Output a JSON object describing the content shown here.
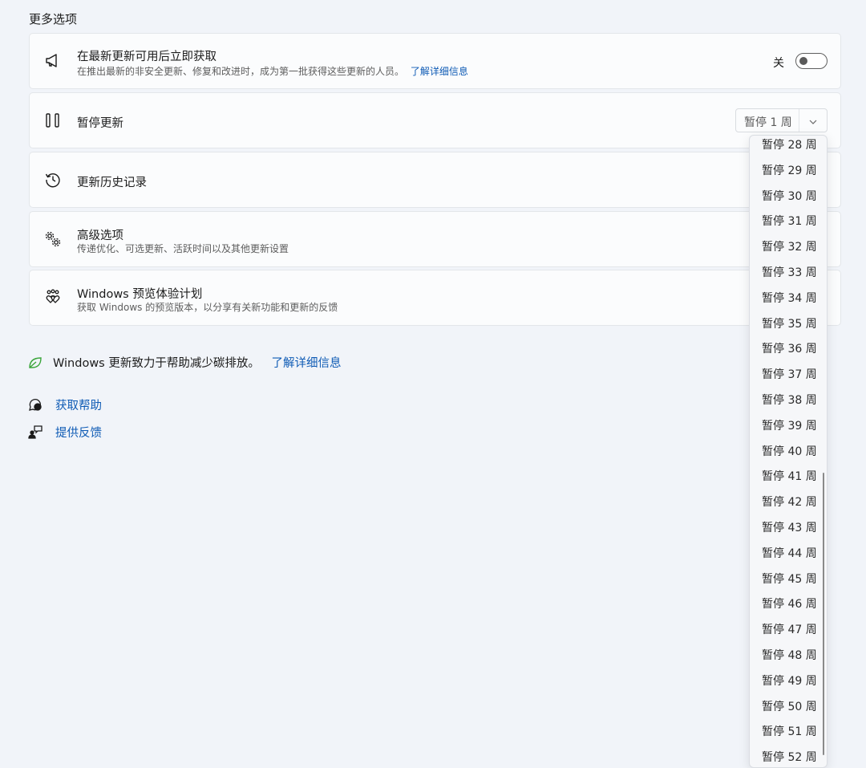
{
  "section": {
    "title": "更多选项"
  },
  "cards": {
    "latest": {
      "title": "在最新更新可用后立即获取",
      "desc": "在推出最新的非安全更新、修复和改进时，成为第一批获得这些更新的人员。",
      "link": "了解详细信息",
      "toggle_label": "关",
      "toggle_state": "off"
    },
    "pause": {
      "title": "暂停更新",
      "select_value": "暂停 1 周"
    },
    "history": {
      "title": "更新历史记录"
    },
    "advanced": {
      "title": "高级选项",
      "desc": "传递优化、可选更新、活跃时间以及其他更新设置"
    },
    "insider": {
      "title": "Windows 预览体验计划",
      "desc": "获取 Windows 的预览版本，以分享有关新功能和更新的反馈"
    }
  },
  "eco": {
    "text": "Windows 更新致力于帮助减少碳排放。",
    "link": "了解详细信息"
  },
  "help": {
    "get_help": "获取帮助",
    "feedback": "提供反馈"
  },
  "dropdown": {
    "options": [
      "暂停 28 周",
      "暂停 29 周",
      "暂停 30 周",
      "暂停 31 周",
      "暂停 32 周",
      "暂停 33 周",
      "暂停 34 周",
      "暂停 35 周",
      "暂停 36 周",
      "暂停 37 周",
      "暂停 38 周",
      "暂停 39 周",
      "暂停 40 周",
      "暂停 41 周",
      "暂停 42 周",
      "暂停 43 周",
      "暂停 44 周",
      "暂停 45 周",
      "暂停 46 周",
      "暂停 47 周",
      "暂停 48 周",
      "暂停 49 周",
      "暂停 50 周",
      "暂停 51 周",
      "暂停 52 周"
    ]
  },
  "colors": {
    "link": "#0f5bb5",
    "eco_green": "#3aa53a",
    "background": "#f1f4f9"
  }
}
